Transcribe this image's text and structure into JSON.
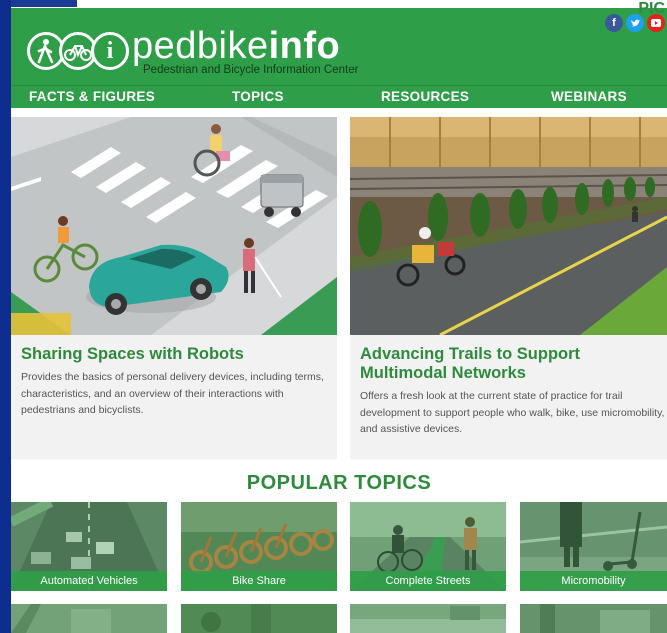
{
  "header": {
    "brand_light": "pedbike",
    "brand_bold": "info",
    "tagline": "Pedestrian and Bicycle Information Center",
    "corner_text": "PIC",
    "social": [
      "f",
      "t",
      "yt"
    ]
  },
  "nav": {
    "items": [
      "FACTS & FIGURES",
      "TOPICS",
      "RESOURCES",
      "WEBINARS"
    ]
  },
  "features": [
    {
      "title": "Sharing Spaces with Robots",
      "description": "Provides the basics of personal delivery devices, including terms, characteristics, and an overview of their interactions with pedestrians and bicyclists."
    },
    {
      "title": "Advancing Trails to Support Multimodal Networks",
      "description": "Offers a fresh look at the current state of practice for trail development to support people who walk, bike, use micromobility, and assistive devices."
    }
  ],
  "popular": {
    "heading": "POPULAR TOPICS",
    "topics": [
      "Automated Vehicles",
      "Bike Share",
      "Complete Streets",
      "Micromobility"
    ]
  },
  "colors": {
    "brand_green": "#2f9e48",
    "title_green": "#2e8b3d",
    "left_bar_blue": "#0d2e8f"
  }
}
